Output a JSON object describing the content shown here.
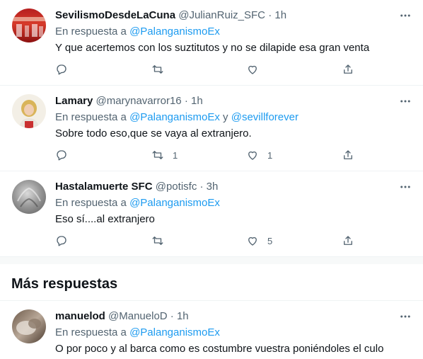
{
  "reply_prefix": "En respuesta a",
  "tweets": [
    {
      "name": "SevilismoDesdeLaCuna",
      "handle": "@JulianRuiz_SFC",
      "sep": "·",
      "time": "1h",
      "mentions": [
        "@PalanganismoEx"
      ],
      "mention_joiner": "",
      "text": "Y que acertemos con los suztitutos y no se dilapide esa gran venta",
      "retweets": "",
      "likes": ""
    },
    {
      "name": "Lamary",
      "handle": "@marynavarror16",
      "sep": "·",
      "time": "1h",
      "mentions": [
        "@PalanganismoEx",
        "@sevillforever"
      ],
      "mention_joiner": "y",
      "text": "Sobre todo eso,que se vaya al extranjero.",
      "retweets": "1",
      "likes": "1"
    },
    {
      "name": "Hastalamuerte SFC",
      "handle": "@potisfc",
      "sep": "·",
      "time": "3h",
      "mentions": [
        "@PalanganismoEx"
      ],
      "mention_joiner": "",
      "text": "Eso sí....al extranjero",
      "retweets": "",
      "likes": "5"
    },
    {
      "name": "manuelod",
      "handle": "@ManueloD",
      "sep": "·",
      "time": "1h",
      "mentions": [
        "@PalanganismoEx"
      ],
      "mention_joiner": "",
      "text": "O por poco y al barca como es costumbre vuestra poniéndoles el culo",
      "retweets": "",
      "likes": ""
    }
  ],
  "section_title": "Más respuestas",
  "colors": {
    "accent": "#1d9bf0",
    "muted": "#536471",
    "text": "#0f1419",
    "divider": "#eff3f4"
  },
  "icons": [
    "reply-icon",
    "retweet-icon",
    "like-icon",
    "share-icon",
    "more-icon"
  ]
}
